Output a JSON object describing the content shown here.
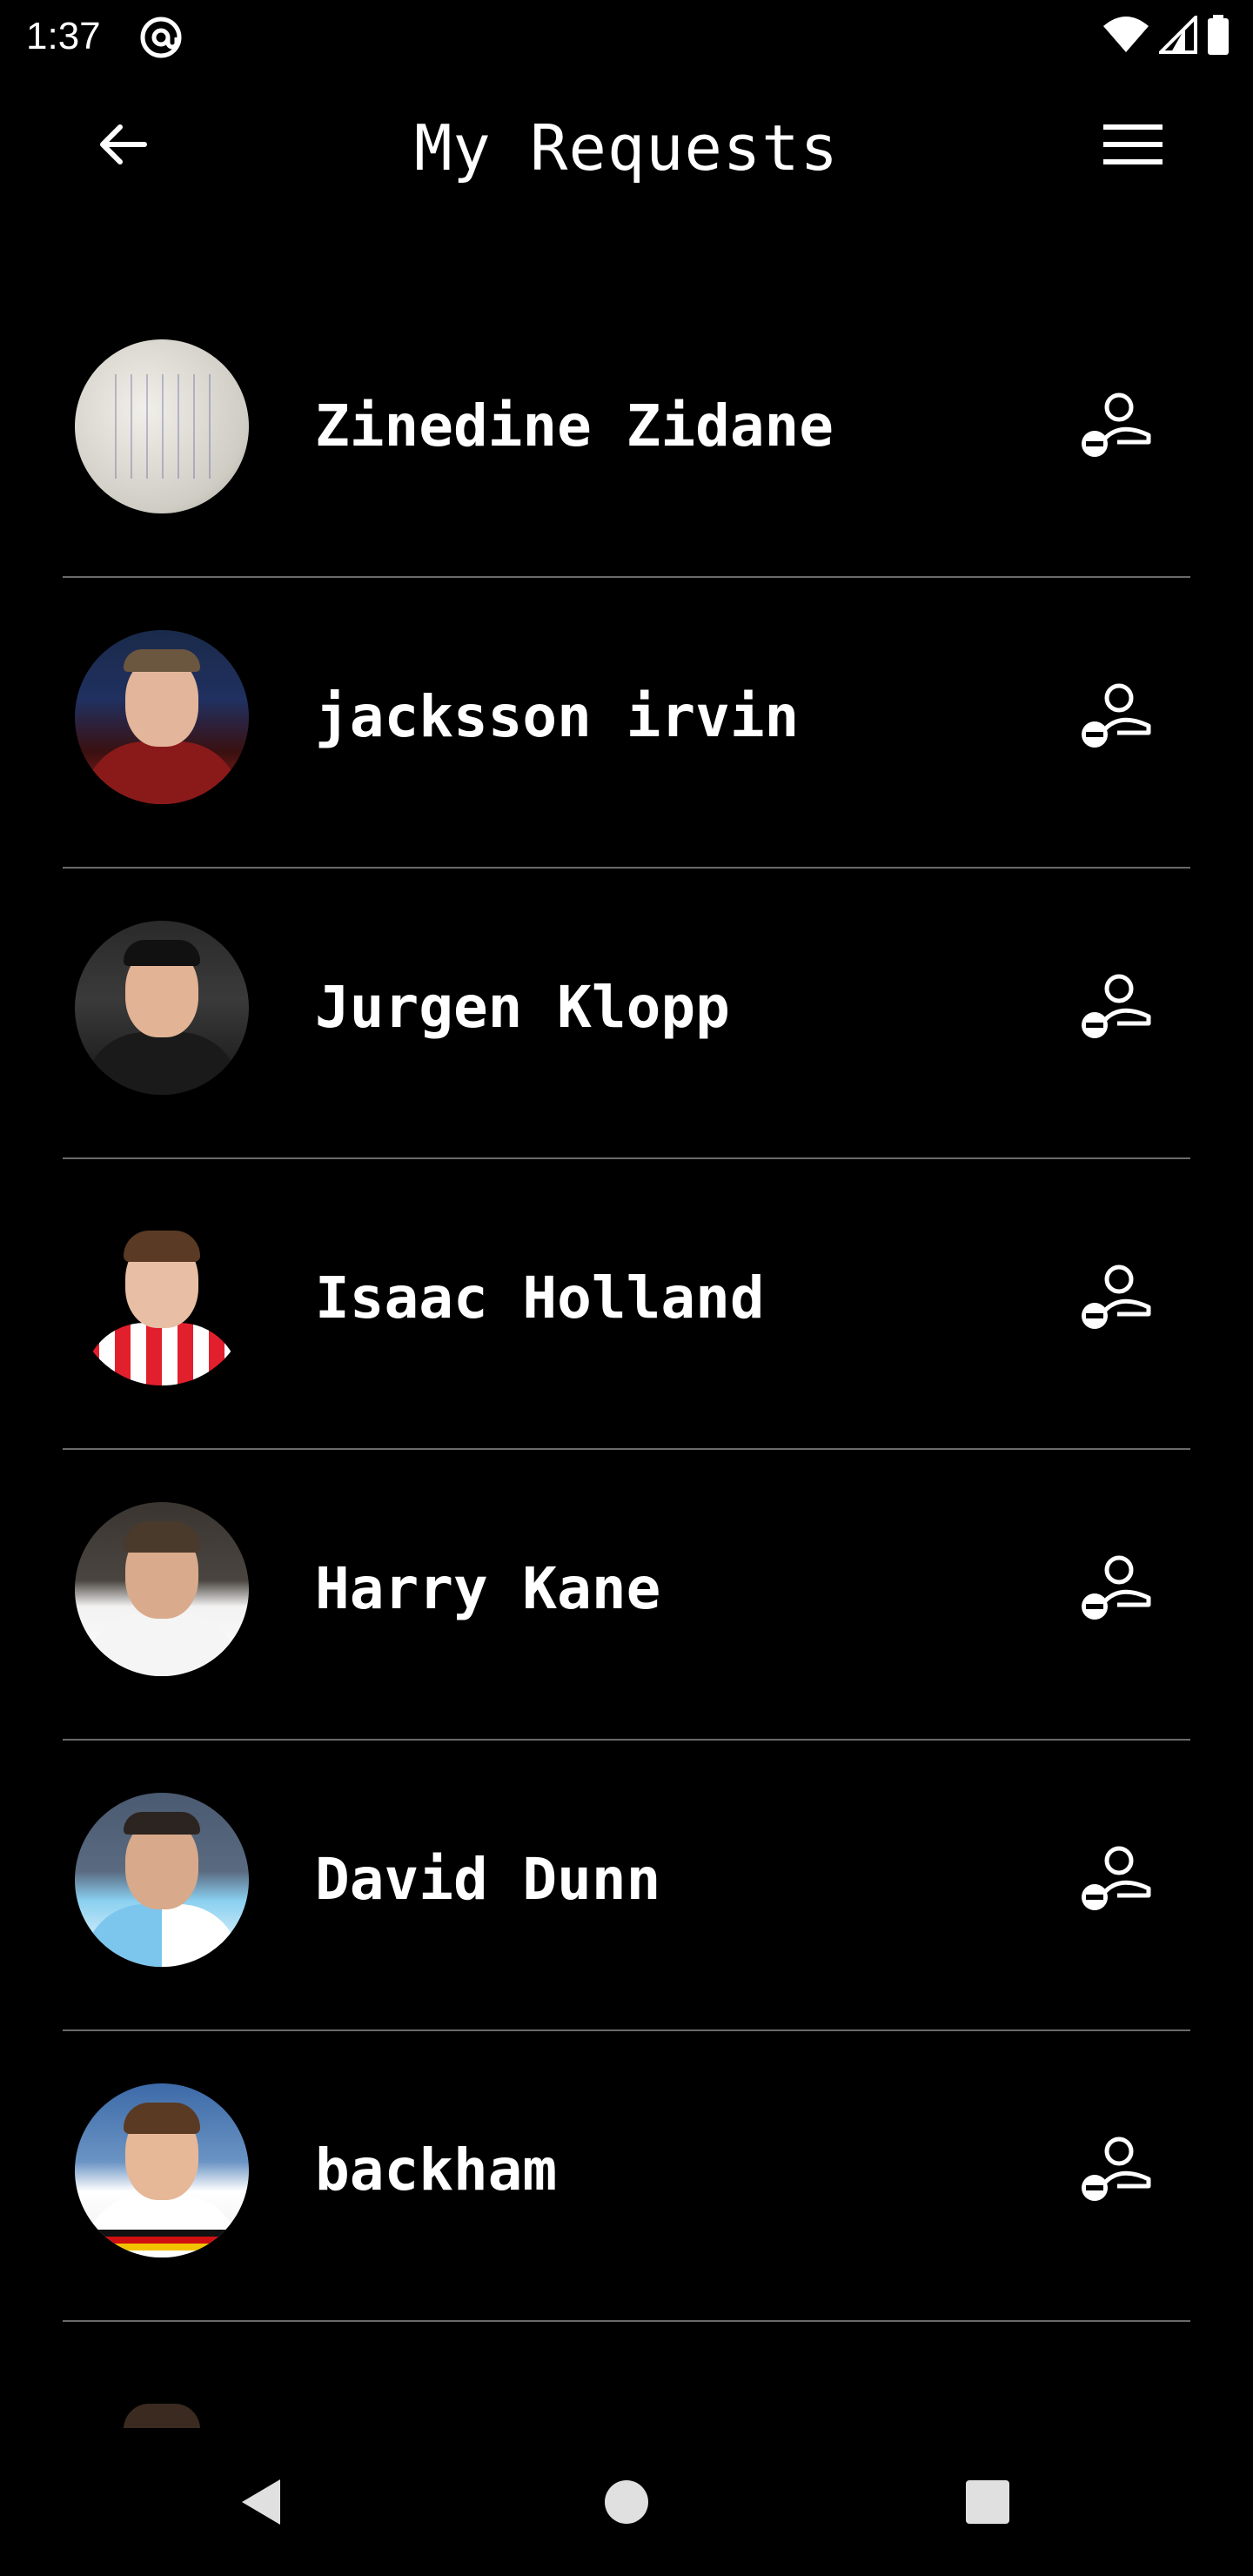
{
  "status_bar": {
    "time": "1:37",
    "app_icon": "at-sign-icon",
    "wifi_icon": "wifi-icon",
    "signal_icon": "signal-icon",
    "battery_icon": "battery-icon"
  },
  "header": {
    "title": "My Requests",
    "back_icon": "arrow-left-icon",
    "menu_icon": "hamburger-menu-icon"
  },
  "requests": [
    {
      "name": "Zinedine Zidane",
      "action_icon": "remove-user-icon"
    },
    {
      "name": "jacksson irvin",
      "action_icon": "remove-user-icon"
    },
    {
      "name": "Jurgen Klopp",
      "action_icon": "remove-user-icon"
    },
    {
      "name": "Isaac Holland",
      "action_icon": "remove-user-icon"
    },
    {
      "name": "Harry Kane",
      "action_icon": "remove-user-icon"
    },
    {
      "name": "David Dunn",
      "action_icon": "remove-user-icon"
    },
    {
      "name": "backham",
      "action_icon": "remove-user-icon"
    }
  ],
  "nav_bar": {
    "back_icon": "nav-back-triangle-icon",
    "home_icon": "nav-home-circle-icon",
    "recents_icon": "nav-recents-square-icon"
  },
  "colors": {
    "background": "#000000",
    "text": "#ffffff",
    "divider": "#6a6a6a",
    "nav_icons": "#e0e0e0"
  }
}
